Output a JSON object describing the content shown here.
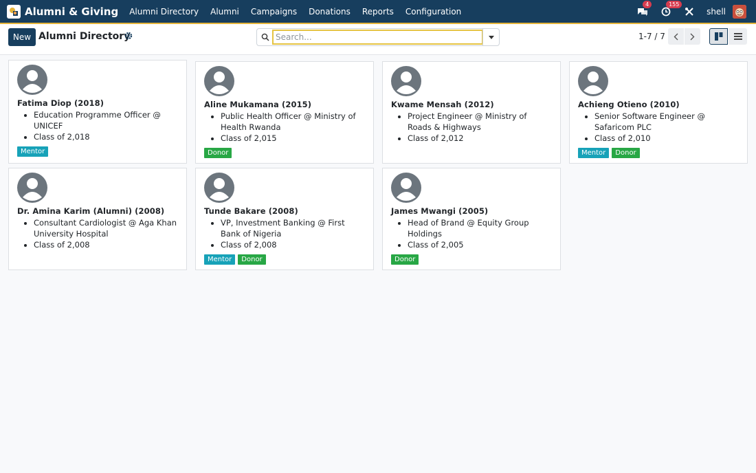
{
  "app": {
    "name": "Alumni & Giving"
  },
  "menu": [
    "Alumni Directory",
    "Alumni",
    "Campaigns",
    "Donations",
    "Reports",
    "Configuration"
  ],
  "nav": {
    "messages_count": "4",
    "activities_count": "155",
    "user": "shell"
  },
  "control": {
    "new_label": "New",
    "title": "Alumni Directory",
    "search_placeholder": "Search...",
    "pager": "1-7 / 7"
  },
  "cards": [
    {
      "name": "Fatima Diop (2018)",
      "job": "Education Programme Officer @ UNICEF",
      "class": "Class of 2,018",
      "tags": [
        "Mentor"
      ]
    },
    {
      "name": "Aline Mukamana (2015)",
      "job": "Public Health Officer @ Ministry of Health Rwanda",
      "class": "Class of 2,015",
      "tags": [
        "Donor"
      ]
    },
    {
      "name": "Kwame Mensah (2012)",
      "job": "Project Engineer @ Ministry of Roads & Highways",
      "class": "Class of 2,012",
      "tags": []
    },
    {
      "name": "Achieng Otieno (2010)",
      "job": "Senior Software Engineer @ Safaricom PLC",
      "class": "Class of 2,010",
      "tags": [
        "Mentor",
        "Donor"
      ]
    },
    {
      "name": "Dr. Amina Karim (Alumni) (2008)",
      "job": "Consultant Cardiologist @ Aga Khan University Hospital",
      "class": "Class of 2,008",
      "tags": []
    },
    {
      "name": "Tunde Bakare (2008)",
      "job": "VP, Investment Banking @ First Bank of Nigeria",
      "class": "Class of 2,008",
      "tags": [
        "Mentor",
        "Donor"
      ]
    },
    {
      "name": "James Mwangi (2005)",
      "job": "Head of Brand @ Equity Group Holdings",
      "class": "Class of 2,005",
      "tags": [
        "Donor"
      ]
    }
  ],
  "colors": {
    "navbar": "#173e5e",
    "mentor": "#17a2b8",
    "donor": "#28a745",
    "badge": "#d63c4f"
  }
}
